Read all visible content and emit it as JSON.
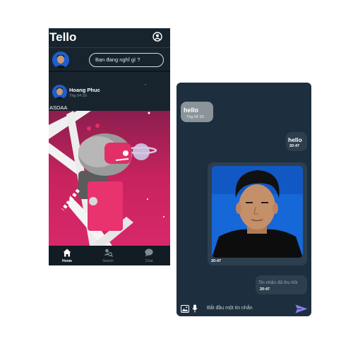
{
  "feed": {
    "app_title": "Tello",
    "composer_placeholder": "Bạn đang nghĩ gì ?",
    "post": {
      "author": "Hoang Phuc",
      "time": "Thg 04 20",
      "text": "ASDAA"
    },
    "nav": [
      {
        "label": "Home",
        "icon": "home-icon",
        "active": true
      },
      {
        "label": "Search",
        "icon": "search-icon",
        "active": false
      },
      {
        "label": "Chat",
        "icon": "chat-icon",
        "active": false
      }
    ]
  },
  "chat": {
    "messages": [
      {
        "direction": "incoming",
        "text": "hello",
        "time": "Thg 06 26"
      },
      {
        "direction": "outgoing",
        "text": "hello",
        "time": "20:47"
      },
      {
        "direction": "outgoing",
        "type": "image",
        "time": "20:47"
      },
      {
        "direction": "outgoing",
        "text": "Tin nhắn đã thu hồi",
        "time": "20:47",
        "recalled": true
      }
    ],
    "input_placeholder": "Bắt đầu một tin nhắn"
  },
  "colors": {
    "feed_background": "#17242e",
    "chat_background": "#1d2f3e",
    "incoming_bubble": "#8a9499",
    "outgoing_bubble": "#2d3f4e",
    "send_accent": "#8b7cf6",
    "post_image_pink": "#c8235e"
  }
}
